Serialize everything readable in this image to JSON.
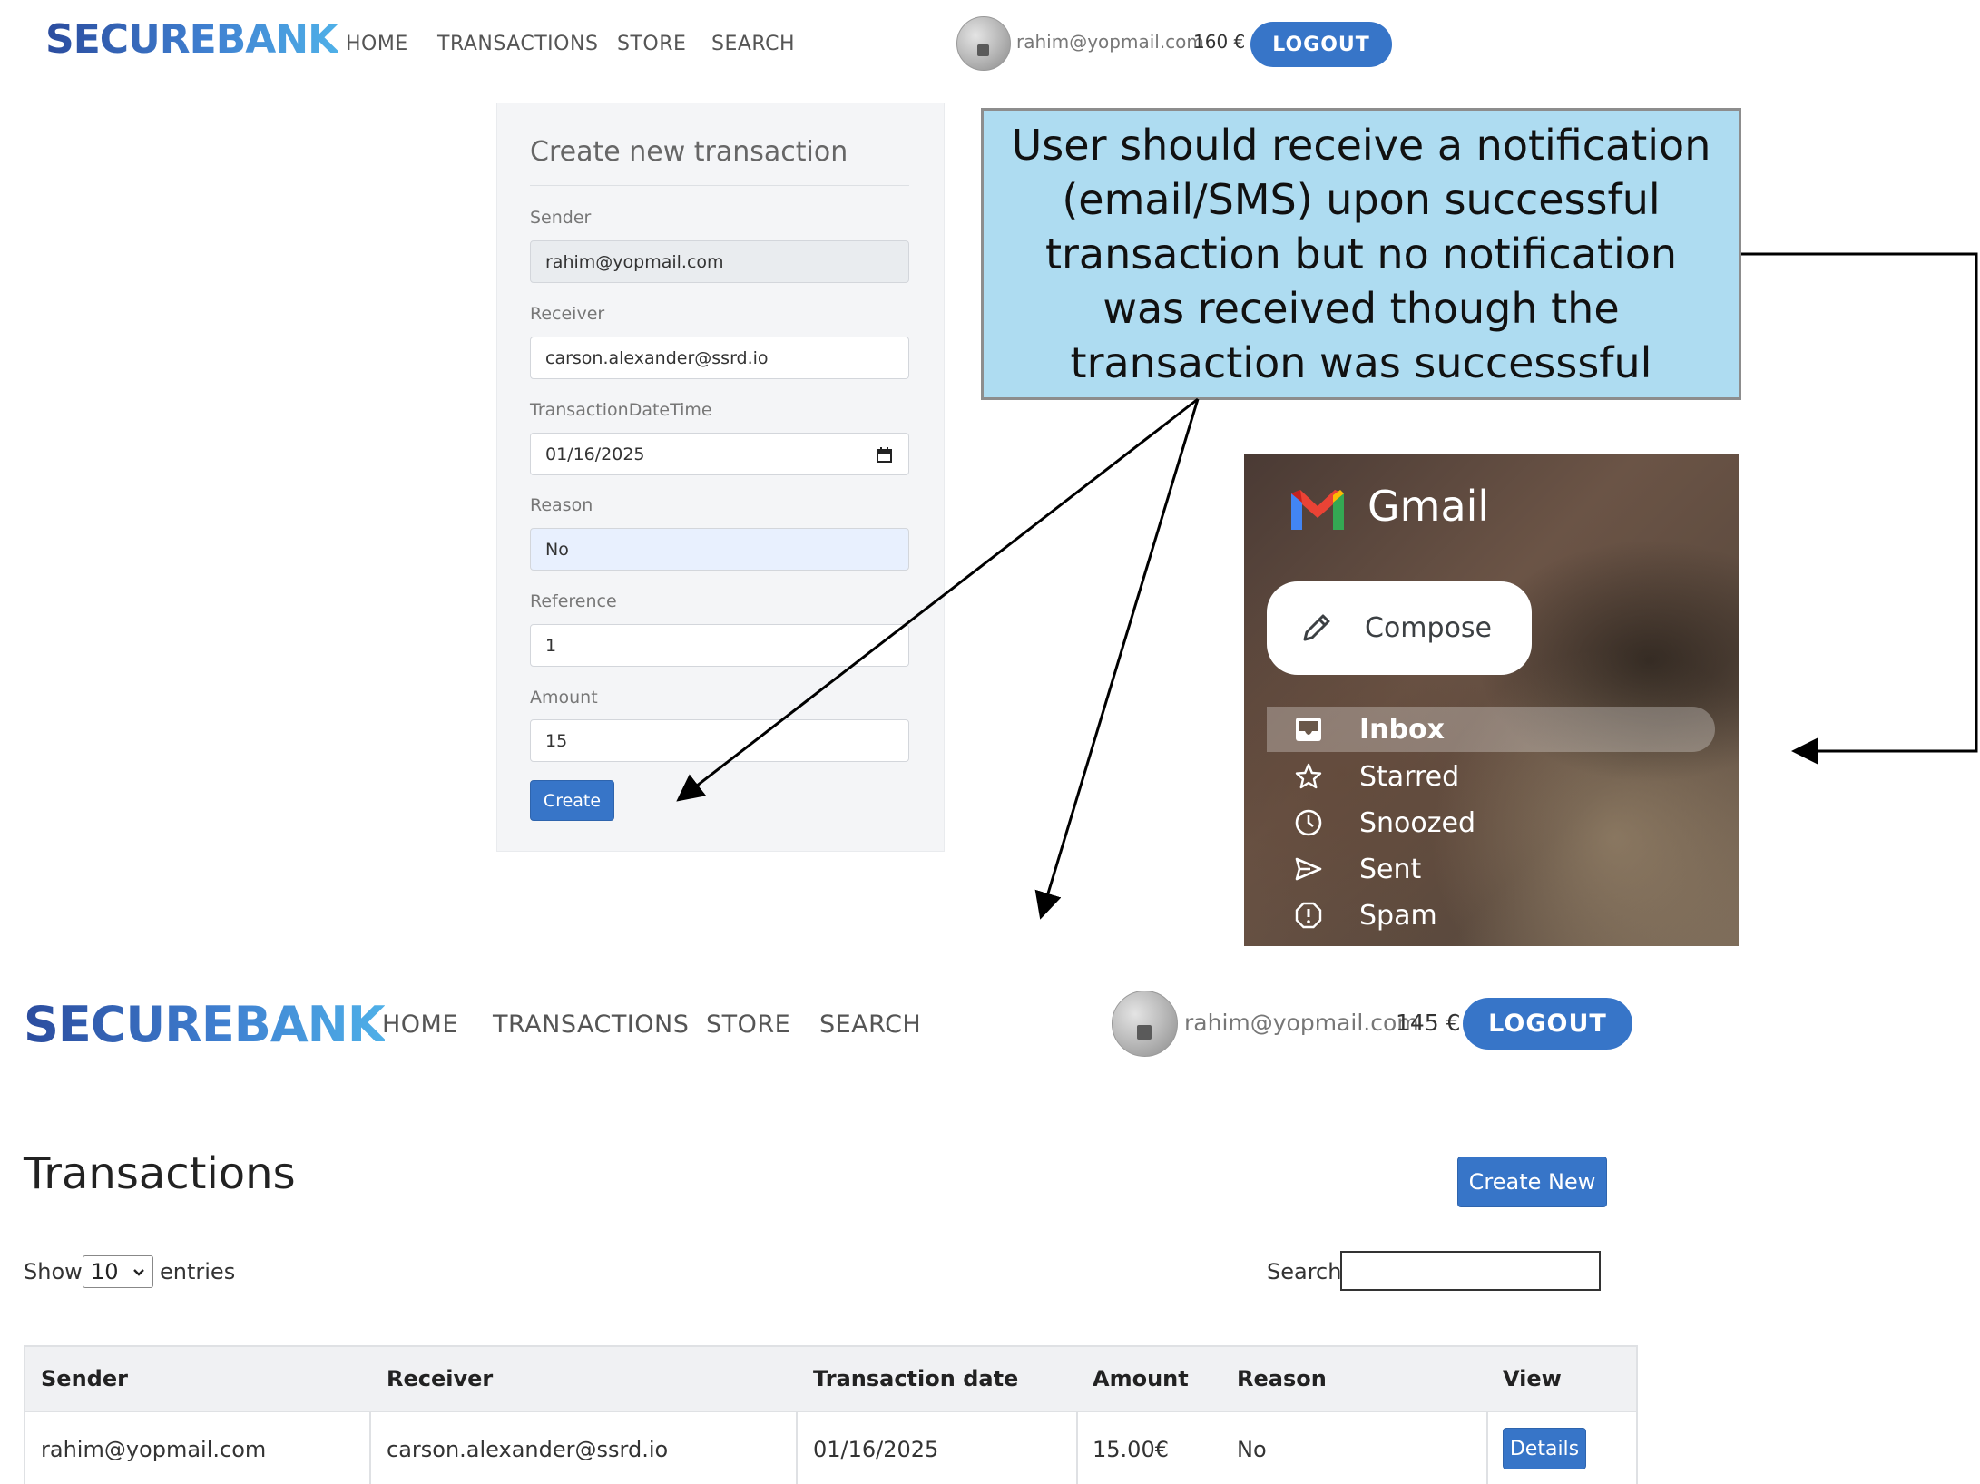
{
  "top_nav": {
    "logo": "SECUREBANK",
    "links": [
      "HOME",
      "TRANSACTIONS",
      "STORE",
      "SEARCH"
    ],
    "user_email": "rahim@yopmail.com",
    "balance": "160 €",
    "logout_label": "LOGOUT"
  },
  "form": {
    "title": "Create new transaction",
    "sender_label": "Sender",
    "sender_value": "rahim@yopmail.com",
    "receiver_label": "Receiver",
    "receiver_value": "carson.alexander@ssrd.io",
    "datetime_label": "TransactionDateTime",
    "datetime_value": "01/16/2025",
    "reason_label": "Reason",
    "reason_value": "No",
    "reference_label": "Reference",
    "reference_value": "1",
    "amount_label": "Amount",
    "amount_value": "15",
    "create_label": "Create"
  },
  "callout": {
    "lines": [
      "User should receive a notification",
      "(email/SMS) upon successful",
      "transaction but no notification",
      "was received though the",
      "transaction was successsful"
    ]
  },
  "gmail": {
    "brand": "Gmail",
    "compose_label": "Compose",
    "items": [
      "Inbox",
      "Starred",
      "Snoozed",
      "Sent",
      "Spam"
    ]
  },
  "bottom_nav": {
    "logo": "SECUREBANK",
    "links": [
      "HOME",
      "TRANSACTIONS",
      "STORE",
      "SEARCH"
    ],
    "user_email": "rahim@yopmail.com",
    "balance": "145 €",
    "logout_label": "LOGOUT"
  },
  "transactions": {
    "title": "Transactions",
    "create_new_label": "Create New",
    "show_label": "Show",
    "entries_value": "10",
    "entries_label": "entries",
    "search_label": "Search:",
    "columns": [
      "Sender",
      "Receiver",
      "Transaction date",
      "Amount",
      "Reason",
      "View"
    ],
    "rows": [
      {
        "sender": "rahim@yopmail.com",
        "receiver": "carson.alexander@ssrd.io",
        "date": "01/16/2025",
        "amount": "15.00€",
        "reason": "No",
        "action": "Details"
      }
    ]
  },
  "colors": {
    "brand_blue": "#3775c8",
    "callout_bg": "#aedcf1"
  }
}
